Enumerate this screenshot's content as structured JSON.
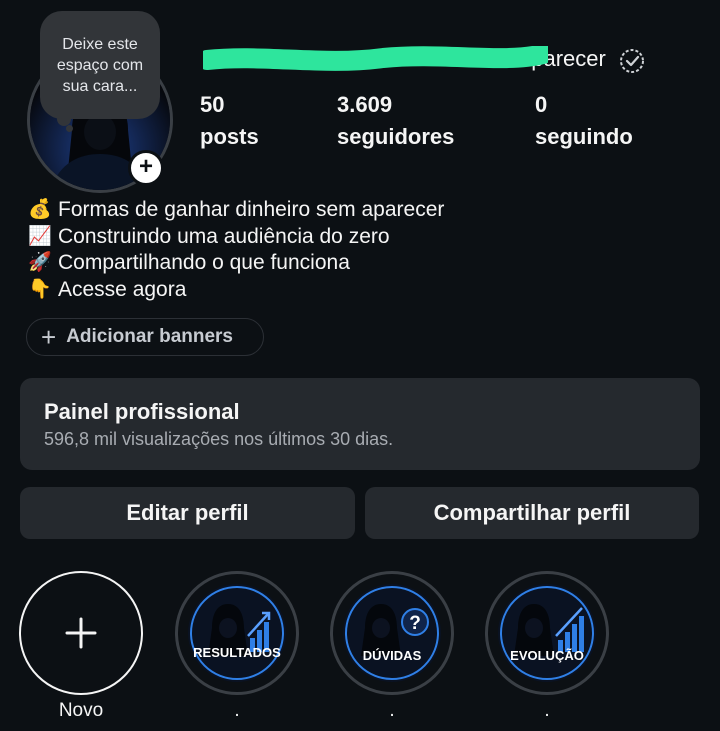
{
  "profile": {
    "username_visible": "aparecer",
    "note": "Deixe este espaço com sua cara...",
    "stats": [
      {
        "value": "50",
        "label": "posts"
      },
      {
        "value": "3.609",
        "label": "seguidores"
      },
      {
        "value": "0",
        "label": "seguindo"
      }
    ],
    "bio": [
      {
        "emoji": "💰",
        "text": "Formas de ganhar dinheiro sem aparecer"
      },
      {
        "emoji": "📈",
        "text": "Construindo uma audiência do zero"
      },
      {
        "emoji": "🚀",
        "text": "Compartilhando o que funciona"
      },
      {
        "emoji": "👇",
        "text": "Acesse agora"
      }
    ],
    "banner_button": "Adicionar banners"
  },
  "panel": {
    "title": "Painel profissional",
    "subtitle": "596,8 mil visualizações nos últimos 30 dias."
  },
  "actions": {
    "edit": "Editar perfil",
    "share": "Compartilhar perfil"
  },
  "highlights": [
    {
      "label": "Novo",
      "cover_text": ""
    },
    {
      "label": ".",
      "cover_text": "RESULTADOS"
    },
    {
      "label": ".",
      "cover_text": "DÚVIDAS"
    },
    {
      "label": ".",
      "cover_text": "EVOLUÇÃO"
    }
  ],
  "colors": {
    "background": "#0c1014",
    "card": "#25292e",
    "redaction": "#2ee59d",
    "accent_blue": "#2f7fe6"
  }
}
